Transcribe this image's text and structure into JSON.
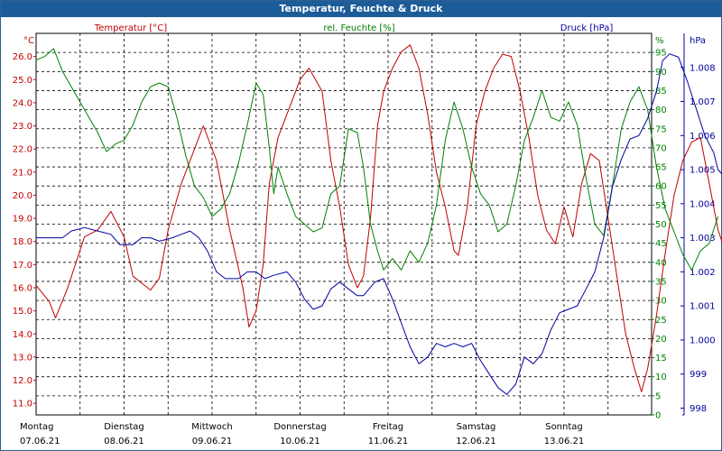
{
  "window": {
    "title": "Temperatur, Feuchte & Druck"
  },
  "colors": {
    "temperature": "#c00000",
    "humidity": "#008000",
    "pressure": "#0000a0",
    "grid": "#000000",
    "titlebar": "#1c5c98"
  },
  "chart_data": {
    "type": "line",
    "title": "Temperatur, Feuchte & Druck",
    "grid": true,
    "x_range": [
      0,
      7
    ],
    "x_ticks": [
      {
        "day": "Montag",
        "date": "07.06.21"
      },
      {
        "day": "Dienstag",
        "date": "08.06.21"
      },
      {
        "day": "Mittwoch",
        "date": "09.06.21"
      },
      {
        "day": "Donnerstag",
        "date": "10.06.21"
      },
      {
        "day": "Freitag",
        "date": "11.06.21"
      },
      {
        "day": "Samstag",
        "date": "12.06.21"
      },
      {
        "day": "Sonntag",
        "date": "13.06.21"
      }
    ],
    "axes": {
      "temperature": {
        "unit": "°C",
        "label": "Temperatur [°C]",
        "min": 10.5,
        "max": 27,
        "ticks": [
          "11.0",
          "12.0",
          "13.0",
          "14.0",
          "15.0",
          "16.0",
          "17.0",
          "18.0",
          "19.0",
          "20.0",
          "21.0",
          "22.0",
          "23.0",
          "24.0",
          "25.0",
          "26.0"
        ]
      },
      "humidity": {
        "unit": "%",
        "label": "rel. Feuchte [%]",
        "min": 0,
        "max": 100,
        "ticks": [
          "0",
          "5",
          "10",
          "15",
          "20",
          "25",
          "30",
          "35",
          "40",
          "45",
          "50",
          "55",
          "60",
          "65",
          "70",
          "75",
          "80",
          "85",
          "90",
          "95"
        ]
      },
      "pressure": {
        "unit": "hPa",
        "label": "Druck [hPa]",
        "min": 997.8,
        "max": 1009,
        "ticks": [
          "998",
          "999",
          "1.000",
          "1.001",
          "1.002",
          "1.003",
          "1.004",
          "1.005",
          "1.006",
          "1.007",
          "1.008"
        ]
      }
    },
    "series": [
      {
        "name": "Temperatur [°C]",
        "axis": "temperature",
        "points": [
          [
            0,
            16.1
          ],
          [
            0.15,
            15.4
          ],
          [
            0.22,
            14.7
          ],
          [
            0.35,
            15.9
          ],
          [
            0.55,
            18.2
          ],
          [
            0.7,
            18.5
          ],
          [
            0.85,
            19.3
          ],
          [
            1.0,
            18.2
          ],
          [
            1.1,
            16.5
          ],
          [
            1.2,
            16.2
          ],
          [
            1.3,
            15.9
          ],
          [
            1.4,
            16.4
          ],
          [
            1.5,
            18.5
          ],
          [
            1.65,
            20.5
          ],
          [
            1.8,
            22.0
          ],
          [
            1.9,
            23.0
          ],
          [
            2.05,
            21.5
          ],
          [
            2.2,
            18.5
          ],
          [
            2.35,
            16.0
          ],
          [
            2.42,
            14.3
          ],
          [
            2.5,
            15.0
          ],
          [
            2.58,
            17.0
          ],
          [
            2.65,
            20.5
          ],
          [
            2.75,
            22.5
          ],
          [
            2.9,
            24.0
          ],
          [
            3.0,
            25.0
          ],
          [
            3.1,
            25.5
          ],
          [
            3.25,
            24.5
          ],
          [
            3.35,
            21.5
          ],
          [
            3.45,
            19.5
          ],
          [
            3.55,
            17.0
          ],
          [
            3.65,
            16.0
          ],
          [
            3.72,
            16.5
          ],
          [
            3.8,
            19.0
          ],
          [
            3.88,
            23.0
          ],
          [
            3.95,
            24.5
          ],
          [
            4.05,
            25.5
          ],
          [
            4.15,
            26.2
          ],
          [
            4.25,
            26.5
          ],
          [
            4.35,
            25.5
          ],
          [
            4.45,
            23.5
          ],
          [
            4.55,
            21.0
          ],
          [
            4.65,
            19.5
          ],
          [
            4.75,
            17.6
          ],
          [
            4.8,
            17.4
          ],
          [
            4.9,
            19.5
          ],
          [
            5.0,
            23.0
          ],
          [
            5.1,
            24.5
          ],
          [
            5.2,
            25.5
          ],
          [
            5.3,
            26.1
          ],
          [
            5.4,
            26.0
          ],
          [
            5.5,
            24.5
          ],
          [
            5.6,
            22.5
          ],
          [
            5.7,
            20.0
          ],
          [
            5.8,
            18.5
          ],
          [
            5.9,
            17.9
          ],
          [
            6.0,
            19.5
          ],
          [
            6.1,
            18.2
          ],
          [
            6.2,
            20.5
          ],
          [
            6.3,
            21.8
          ],
          [
            6.4,
            21.5
          ],
          [
            6.5,
            19.0
          ],
          [
            6.6,
            16.5
          ],
          [
            6.7,
            14.0
          ],
          [
            6.8,
            12.5
          ],
          [
            6.88,
            11.5
          ],
          [
            6.95,
            12.5
          ],
          [
            7.05,
            14.8
          ],
          [
            7.15,
            17.5
          ],
          [
            7.25,
            20.0
          ],
          [
            7.35,
            21.5
          ],
          [
            7.45,
            22.3
          ],
          [
            7.55,
            22.5
          ],
          [
            7.65,
            20.5
          ],
          [
            7.75,
            18.5
          ],
          [
            7.82,
            17.7
          ]
        ]
      },
      {
        "name": "rel. Feuchte [%]",
        "axis": "humidity",
        "points": [
          [
            0,
            93
          ],
          [
            0.1,
            94
          ],
          [
            0.2,
            96
          ],
          [
            0.3,
            90
          ],
          [
            0.4,
            86
          ],
          [
            0.5,
            82
          ],
          [
            0.6,
            78
          ],
          [
            0.7,
            74
          ],
          [
            0.8,
            69
          ],
          [
            0.9,
            71
          ],
          [
            1.0,
            72
          ],
          [
            1.1,
            76
          ],
          [
            1.2,
            82
          ],
          [
            1.3,
            86
          ],
          [
            1.4,
            87
          ],
          [
            1.5,
            86
          ],
          [
            1.6,
            78
          ],
          [
            1.7,
            68
          ],
          [
            1.8,
            60
          ],
          [
            1.9,
            57
          ],
          [
            2.0,
            52
          ],
          [
            2.1,
            54
          ],
          [
            2.2,
            58
          ],
          [
            2.3,
            66
          ],
          [
            2.4,
            76
          ],
          [
            2.5,
            87
          ],
          [
            2.58,
            84
          ],
          [
            2.65,
            70
          ],
          [
            2.7,
            58
          ],
          [
            2.75,
            65
          ],
          [
            2.85,
            58
          ],
          [
            2.95,
            52
          ],
          [
            3.05,
            50
          ],
          [
            3.15,
            48
          ],
          [
            3.25,
            49
          ],
          [
            3.35,
            58
          ],
          [
            3.45,
            60
          ],
          [
            3.55,
            75
          ],
          [
            3.65,
            74
          ],
          [
            3.72,
            65
          ],
          [
            3.8,
            50
          ],
          [
            3.88,
            43
          ],
          [
            3.95,
            38
          ],
          [
            4.05,
            41
          ],
          [
            4.15,
            38
          ],
          [
            4.25,
            43
          ],
          [
            4.35,
            40
          ],
          [
            4.45,
            45
          ],
          [
            4.55,
            55
          ],
          [
            4.65,
            72
          ],
          [
            4.75,
            82
          ],
          [
            4.85,
            75
          ],
          [
            4.95,
            65
          ],
          [
            5.05,
            58
          ],
          [
            5.15,
            55
          ],
          [
            5.25,
            48
          ],
          [
            5.35,
            50
          ],
          [
            5.45,
            60
          ],
          [
            5.55,
            72
          ],
          [
            5.65,
            78
          ],
          [
            5.75,
            85
          ],
          [
            5.85,
            78
          ],
          [
            5.95,
            77
          ],
          [
            6.05,
            82
          ],
          [
            6.15,
            76
          ],
          [
            6.25,
            62
          ],
          [
            6.35,
            50
          ],
          [
            6.45,
            47
          ],
          [
            6.55,
            60
          ],
          [
            6.65,
            75
          ],
          [
            6.75,
            82
          ],
          [
            6.85,
            86
          ],
          [
            6.95,
            80
          ],
          [
            7.05,
            65
          ],
          [
            7.15,
            54
          ],
          [
            7.25,
            48
          ],
          [
            7.35,
            42
          ],
          [
            7.45,
            38
          ],
          [
            7.55,
            43
          ],
          [
            7.65,
            45
          ],
          [
            7.75,
            52
          ]
        ]
      },
      {
        "name": "Druck [hPa]",
        "axis": "pressure",
        "points": [
          [
            0,
            1003.0
          ],
          [
            0.15,
            1003.0
          ],
          [
            0.3,
            1003.0
          ],
          [
            0.4,
            1003.2
          ],
          [
            0.55,
            1003.3
          ],
          [
            0.7,
            1003.2
          ],
          [
            0.85,
            1003.1
          ],
          [
            0.95,
            1002.8
          ],
          [
            1.1,
            1002.8
          ],
          [
            1.2,
            1003.0
          ],
          [
            1.3,
            1003.0
          ],
          [
            1.4,
            1002.9
          ],
          [
            1.55,
            1003.0
          ],
          [
            1.65,
            1003.1
          ],
          [
            1.75,
            1003.2
          ],
          [
            1.85,
            1003.0
          ],
          [
            1.95,
            1002.6
          ],
          [
            2.05,
            1002.0
          ],
          [
            2.15,
            1001.8
          ],
          [
            2.3,
            1001.8
          ],
          [
            2.4,
            1002.0
          ],
          [
            2.5,
            1002.0
          ],
          [
            2.6,
            1001.8
          ],
          [
            2.7,
            1001.9
          ],
          [
            2.85,
            1002.0
          ],
          [
            2.95,
            1001.7
          ],
          [
            3.05,
            1001.2
          ],
          [
            3.15,
            1000.9
          ],
          [
            3.25,
            1001.0
          ],
          [
            3.35,
            1001.5
          ],
          [
            3.45,
            1001.7
          ],
          [
            3.55,
            1001.5
          ],
          [
            3.65,
            1001.3
          ],
          [
            3.72,
            1001.3
          ],
          [
            3.85,
            1001.7
          ],
          [
            3.95,
            1001.8
          ],
          [
            4.05,
            1001.2
          ],
          [
            4.15,
            1000.5
          ],
          [
            4.25,
            999.8
          ],
          [
            4.35,
            999.3
          ],
          [
            4.45,
            999.5
          ],
          [
            4.55,
            999.9
          ],
          [
            4.65,
            999.8
          ],
          [
            4.75,
            999.9
          ],
          [
            4.85,
            999.8
          ],
          [
            4.95,
            999.9
          ],
          [
            5.05,
            999.4
          ],
          [
            5.15,
            999.0
          ],
          [
            5.25,
            998.6
          ],
          [
            5.35,
            998.4
          ],
          [
            5.45,
            998.7
          ],
          [
            5.55,
            999.5
          ],
          [
            5.65,
            999.3
          ],
          [
            5.75,
            999.6
          ],
          [
            5.85,
            1000.3
          ],
          [
            5.95,
            1000.8
          ],
          [
            6.05,
            1000.9
          ],
          [
            6.15,
            1001.0
          ],
          [
            6.25,
            1001.5
          ],
          [
            6.35,
            1002.0
          ],
          [
            6.45,
            1003.0
          ],
          [
            6.55,
            1004.5
          ],
          [
            6.65,
            1005.3
          ],
          [
            6.75,
            1005.9
          ],
          [
            6.85,
            1006.0
          ],
          [
            6.95,
            1006.5
          ],
          [
            7.05,
            1007.3
          ],
          [
            7.12,
            1008.2
          ],
          [
            7.2,
            1008.4
          ],
          [
            7.3,
            1008.3
          ],
          [
            7.4,
            1007.6
          ],
          [
            7.5,
            1006.8
          ],
          [
            7.6,
            1006.0
          ],
          [
            7.7,
            1005.5
          ],
          [
            7.75,
            1005.0
          ],
          [
            7.82,
            1004.8
          ],
          [
            7.88,
            1004.3
          ]
        ]
      }
    ]
  }
}
